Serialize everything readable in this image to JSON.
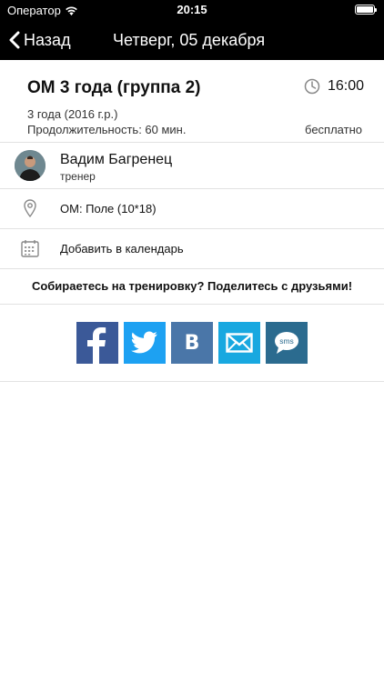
{
  "status_bar": {
    "carrier": "Оператор",
    "time": "20:15"
  },
  "nav": {
    "back_label": "Назад",
    "title": "Четверг, 05 декабря"
  },
  "event": {
    "title": "ОМ 3 года (группа 2)",
    "time": "16:00",
    "age": "3 года (2016 г.р.)",
    "duration": "Продолжительность: 60 мин.",
    "price": "бесплатно"
  },
  "trainer": {
    "name": "Вадим Багренец",
    "role": "тренер"
  },
  "location": {
    "label": "ОМ: Поле (10*18)"
  },
  "calendar": {
    "label": "Добавить в календарь"
  },
  "share": {
    "prompt": "Собираетесь на тренировку? Поделитесь с друзьями!",
    "buttons": [
      {
        "name": "facebook",
        "color": "#3b5998",
        "glyph": "f"
      },
      {
        "name": "twitter",
        "color": "#1da1f2"
      },
      {
        "name": "vk",
        "color": "#4a76a8",
        "glyph": "В"
      },
      {
        "name": "email",
        "color": "#18a8e0"
      },
      {
        "name": "sms",
        "color": "#2b6b8f",
        "glyph": "sms"
      }
    ]
  },
  "colors": {
    "bar": "#000000",
    "divider": "#e2e2e2"
  }
}
